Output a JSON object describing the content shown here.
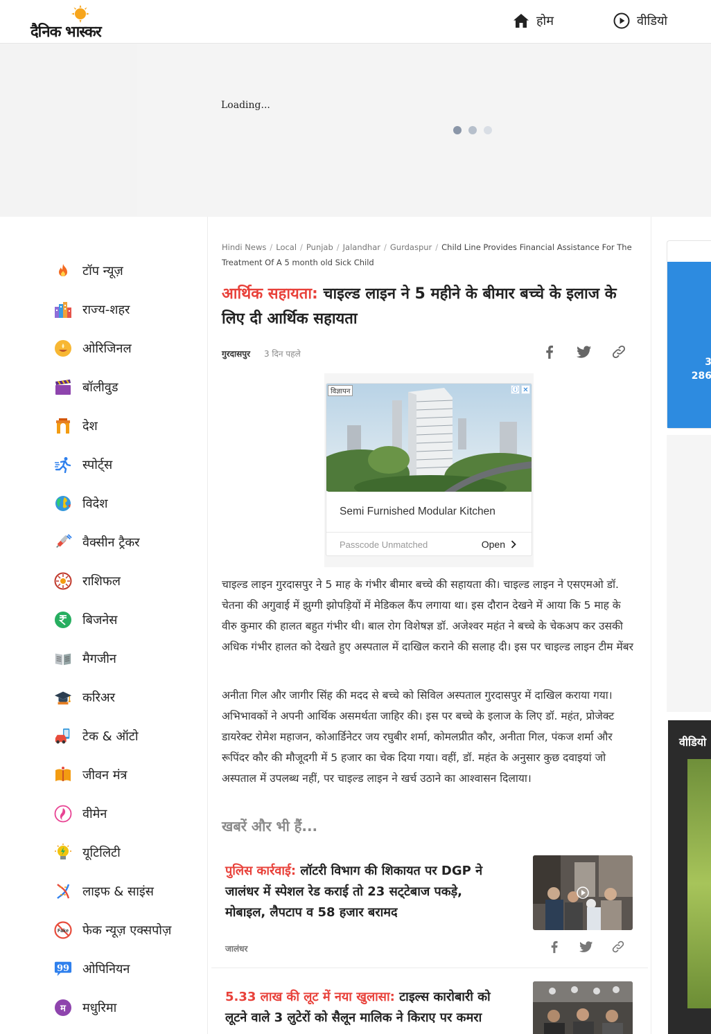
{
  "header": {
    "logo_text": "दैनिक भास्कर",
    "nav": [
      {
        "label": "होम",
        "icon": "home-icon"
      },
      {
        "label": "वीडियो",
        "icon": "play-circle-icon"
      }
    ]
  },
  "banner": {
    "loading_text": "Loading...",
    "dot_colors": [
      "#8a96a8",
      "#b6bfcb",
      "#d9dee5"
    ]
  },
  "sidebar": {
    "items": [
      {
        "label": "टॉप न्यूज़",
        "icon": "fire-icon"
      },
      {
        "label": "राज्य-शहर",
        "icon": "city-buildings-icon"
      },
      {
        "label": "ओरिजिनल",
        "icon": "lamp-icon"
      },
      {
        "label": "बॉलीवुड",
        "icon": "clapperboard-icon"
      },
      {
        "label": "देश",
        "icon": "india-gate-icon"
      },
      {
        "label": "स्पोर्ट्स",
        "icon": "runner-icon"
      },
      {
        "label": "विदेश",
        "icon": "globe-icon"
      },
      {
        "label": "वैक्सीन ट्रैकर",
        "icon": "syringe-icon"
      },
      {
        "label": "राशिफल",
        "icon": "zodiac-icon"
      },
      {
        "label": "बिजनेस",
        "icon": "rupee-icon"
      },
      {
        "label": "मैगजीन",
        "icon": "magazine-icon"
      },
      {
        "label": "करिअर",
        "icon": "graduation-cap-icon"
      },
      {
        "label": "टेक & ऑटो",
        "icon": "tech-auto-icon"
      },
      {
        "label": "जीवन मंत्र",
        "icon": "book-icon"
      },
      {
        "label": "वीमेन",
        "icon": "women-icon"
      },
      {
        "label": "यूटिलिटी",
        "icon": "bulb-icon"
      },
      {
        "label": "लाइफ & साइंस",
        "icon": "dna-icon"
      },
      {
        "label": "फेक न्यूज़ एक्सपोज़",
        "icon": "fake-news-icon"
      },
      {
        "label": "ओपिनियन",
        "icon": "quote-bubble-icon"
      },
      {
        "label": "मधुरिमा",
        "icon": "madhurima-icon"
      }
    ]
  },
  "article": {
    "breadcrumb": [
      "Hindi News",
      "Local",
      "Punjab",
      "Jalandhar",
      "Gurdaspur"
    ],
    "breadcrumb_current": "Child Line Provides Financial Assistance For The Treatment Of A 5 month old Sick Child",
    "kicker": "आर्थिक सहायता:",
    "title": " चाइल्ड लाइन ने 5 महीने के बीमार बच्चे के इलाज के लिए दी आर्थिक सहायता",
    "city": "गुरदासपुर",
    "time": "3 दिन पहले",
    "paragraphs": [
      "चाइल्ड लाइन गुरदासपुर ने 5 माह के गंभीर बीमार बच्चे की सहायता की। चाइल्ड लाइन ने एसएमओ डॉ. चेतना की अगुवाई में झुग्गी झोपड़ियों में मेडिकल कैंप लगाया था। इस दौरान देखने में आया कि 5 माह के वीरु कुमार की हालत बहुत गंभीर थी। बाल रोग विशेषज्ञ डॉ. अजेश्वर महंत ने बच्चे के चेकअप कर उसकी अधिक गंभीर हालत को देखते हुए अस्पताल में दाखिल कराने की सलाह दी। इस पर चाइल्ड लाइन टीम मेंबर",
      "अनीता गिल और जागीर सिंह की मदद से बच्चे को सिविल अस्पताल गुरदासपुर में दाखिल कराया गया। अभिभावकों ने अपनी आर्थिक असमर्थता जाहिर की। इस पर बच्चे के इलाज के लिए डॉ. महंत, प्रोजेक्ट डायरेक्ट रोमेश महाजन, कोआर्डिनेटर जय रघुबीर शर्मा, कोमलप्रीत कौर, अनीता गिल, पंकज शर्मा और रूपिंदर कौर की मौजूदगी में 5 हजार का चेक दिया गया। वहीं, डॉ. महंत के अनुसार कुछ दवाइयां जो अस्पताल में उपलब्ध नहीं, पर चाइल्ड लाइन ने खर्च उठाने का आश्वासन दिलाया।"
    ],
    "more_heading": "खबरें और भी हैं..."
  },
  "ad": {
    "tag": "विज्ञापन",
    "title": "Semi Furnished Modular Kitchen",
    "footer_left": "Passcode Unmatched",
    "footer_right": "Open"
  },
  "stories": [
    {
      "kicker": "पुलिस कार्रवाई:",
      "title": " लॉटरी विभाग की शिकायत पर DGP ने जालंधर में स्पेशल रेड कराई तो 23 सट्‌टेबाज पकड़े, मोबाइल, लैपटाप व 58 हजार बरामद",
      "city": "जालंधर"
    },
    {
      "kicker": "5.33 लाख की लूट में नया खुलासा:",
      "title": " टाइल्स कारोबारी को लूटने वाले 3 लुटेरों को सैलून मालिक ने किराए पर कमरा"
    }
  ],
  "right_rail": {
    "number_line1": "3",
    "number_line2": "286",
    "video_label": "वीडियो"
  },
  "colors": {
    "kicker_red": "#e8413a",
    "right_blue": "#2d8be0"
  }
}
